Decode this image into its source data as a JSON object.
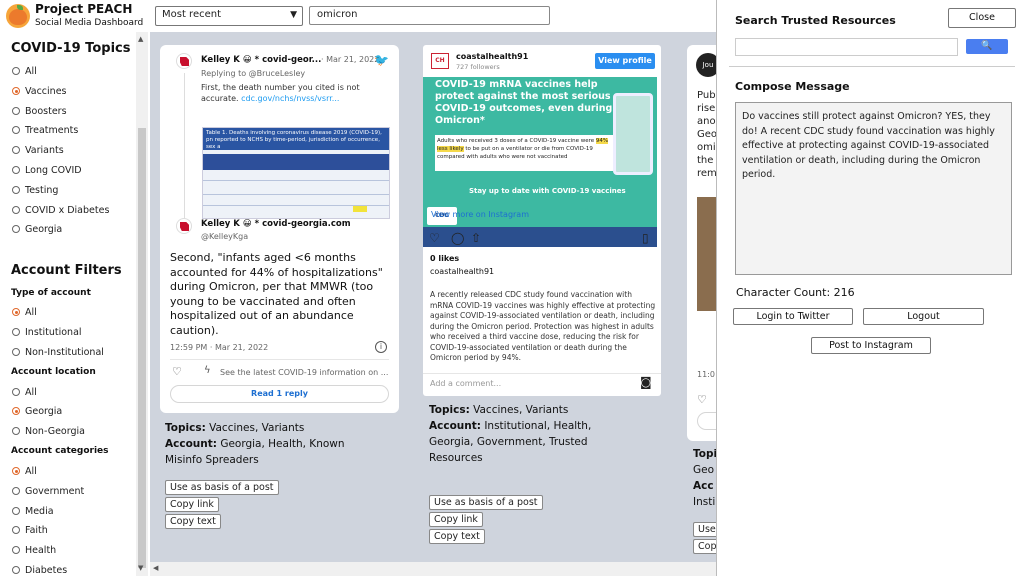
{
  "header": {
    "brand_title": "Project PEACH",
    "brand_subtitle": "Social Media Dashboard",
    "sort_value": "Most recent",
    "search_value": "omicron"
  },
  "sidebar": {
    "topics_title": "COVID-19 Topics",
    "topics": [
      {
        "label": "All",
        "selected": false
      },
      {
        "label": "Vaccines",
        "selected": true
      },
      {
        "label": "Boosters",
        "selected": false
      },
      {
        "label": "Treatments",
        "selected": false
      },
      {
        "label": "Variants",
        "selected": false
      },
      {
        "label": "Long COVID",
        "selected": false
      },
      {
        "label": "Testing",
        "selected": false
      },
      {
        "label": "COVID x Diabetes",
        "selected": false
      },
      {
        "label": "Georgia",
        "selected": false
      }
    ],
    "filters_title": "Account Filters",
    "type_title": "Type of account",
    "type_options": [
      {
        "label": "All",
        "selected": true
      },
      {
        "label": "Institutional",
        "selected": false
      },
      {
        "label": "Non-Institutional",
        "selected": false
      }
    ],
    "location_title": "Account location",
    "location_options": [
      {
        "label": "All",
        "selected": false
      },
      {
        "label": "Georgia",
        "selected": true
      },
      {
        "label": "Non-Georgia",
        "selected": false
      }
    ],
    "categories_title": "Account categories",
    "category_options": [
      {
        "label": "All",
        "selected": true
      },
      {
        "label": "Government",
        "selected": false
      },
      {
        "label": "Media",
        "selected": false
      },
      {
        "label": "Faith",
        "selected": false
      },
      {
        "label": "Health",
        "selected": false
      },
      {
        "label": "Diabetes",
        "selected": false
      }
    ]
  },
  "tweet_card": {
    "reply_name": "Kelley K 😀 * covid-geor...",
    "reply_date": "· Mar 21, 2022",
    "replying_to": "Replying to @BruceLesley",
    "reply_text": "First, the death number you cited is not accurate.",
    "reply_link": "cdc.gov/nchs/nvss/vsrr...",
    "table_title": "Table 1. Deaths involving coronavirus disease 2019 (COVID-19), pn reported to NCHS by time-period, jurisdiction of occurrence, sex a",
    "main_name": "Kelley K 😀 * covid-georgia.com",
    "main_handle": "@KelleyKga",
    "main_text": "Second, \"infants aged <6 months accounted for 44% of hospitalizations\" during Omicron, per that MMWR (too young to be vaccinated and often hospitalized out of an abundance caution).",
    "timestamp": "12:59 PM · Mar 21, 2022",
    "info_text": "See the latest COVID-19 information on ...",
    "read_reply": "Read 1 reply",
    "topics_label": "Topics:",
    "topics_value": "Vaccines, Variants",
    "account_label": "Account:",
    "account_value": "Georgia, Health, Known Misinfo Spreaders",
    "btn_basis": "Use as basis of a post",
    "btn_copy_link": "Copy link",
    "btn_copy_text": "Copy text"
  },
  "ig_card": {
    "account": "coastalhealth91",
    "followers": "727 followers",
    "view_profile": "View profile",
    "img_headline": "COVID-19 mRNA vaccines help protect against the most serious COVID-19 outcomes, even during Omicron*",
    "img_band": "Adults who received 3 doses of a COVID-19 vaccine were",
    "img_band_hl": "94% less likely",
    "img_band_rest": "to be put on a ventilator or die from COVID-19 compared with adults who were not vaccinated",
    "img_stay": "Stay up to date with COVID-19 vaccines",
    "img_cdc": "CDC",
    "view_more": "View more on Instagram",
    "likes": "0 likes",
    "caption_user": "coastalhealth91",
    "caption": "A recently released CDC study found vaccination with mRNA COVID-19 vaccines was highly effective at protecting against COVID-19-associated ventilation or death, including during the Omicron period. Protection was highest in adults who received a third vaccine dose, reducing the risk for COVID-19-associated ventilation or death during the Omicron period by 94%.",
    "add_comment": "Add a comment...",
    "topics_label": "Topics:",
    "topics_value": "Vaccines, Variants",
    "account_label": "Account:",
    "account_value": "Institutional, Health, Georgia, Government, Trusted Resources",
    "btn_basis": "Use as basis of a post",
    "btn_copy_link": "Copy link",
    "btn_copy_text": "Copy text"
  },
  "card3": {
    "badge": "Jou",
    "t1": "Pub",
    "t2": "rise",
    "t3": "ano",
    "t4": "Geo",
    "t5": "omi",
    "t6": "the",
    "t7": "rem",
    "ts": "11:0",
    "topics": "Topi",
    "acc1": "Geo",
    "acc2": "Acc",
    "acc3": "Insti",
    "btn1": "Use",
    "btn2": "Cop"
  },
  "right_panel": {
    "search_title": "Search Trusted Resources",
    "close_btn": "Close",
    "compose_title": "Compose Message",
    "compose_text": "Do vaccines still protect against Omicron? YES, they do! A recent CDC study found vaccination was highly effective at protecting against COVID-19-associated ventilation or death, including during the Omicron period.",
    "char_count": "Character Count: 216",
    "login_twitter": "Login to Twitter",
    "logout": "Logout",
    "post_instagram": "Post to Instagram"
  }
}
